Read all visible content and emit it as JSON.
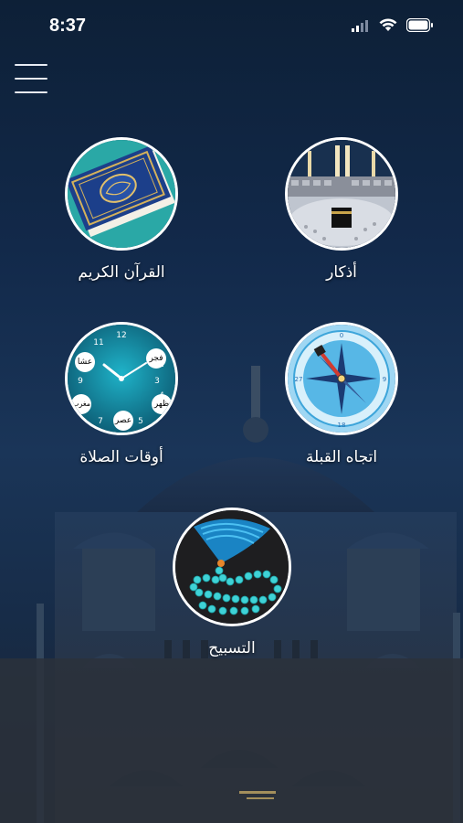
{
  "status_bar": {
    "time": "8:37"
  },
  "menu": {
    "icon": "hamburger-menu-icon"
  },
  "tiles": [
    {
      "label": "أذكار",
      "icon": "kaaba-image"
    },
    {
      "label": "القرآن الكريم",
      "icon": "quran-book-image"
    },
    {
      "label": "اتجاه القبلة",
      "icon": "compass-image"
    },
    {
      "label": "أوقات الصلاة",
      "icon": "prayer-clock-image",
      "clock_labels": [
        "فجر",
        "ظهر",
        "عصر",
        "مغرب",
        "عشا"
      ]
    },
    {
      "label": "التسبيح",
      "icon": "prayer-beads-image"
    }
  ],
  "colors": {
    "background_top": "#0d2037",
    "background_mid": "#1a3558",
    "accent_teal": "#1fb3c9",
    "border": "#ffffff"
  }
}
